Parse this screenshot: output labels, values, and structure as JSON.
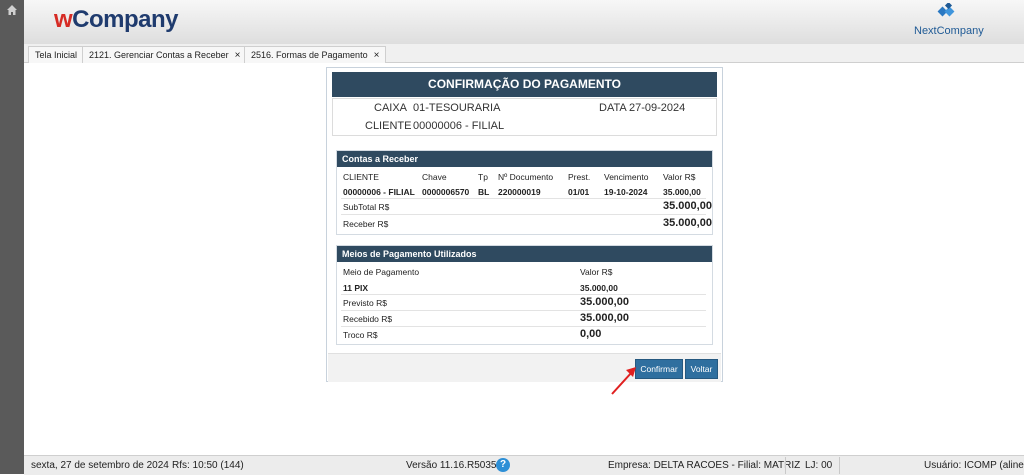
{
  "header": {
    "logo_w": "w",
    "logo_rest": "Company",
    "partner_logo": "NextCompany",
    "home_icon": "home-icon"
  },
  "tabs": [
    {
      "label": "Tela Inicial",
      "closable": false
    },
    {
      "label": "2121. Gerenciar Contas a Receber",
      "closable": true
    },
    {
      "label": "2516. Formas de Pagamento",
      "closable": true
    }
  ],
  "tab_close": "×",
  "dialog": {
    "title": "CONFIRMAÇÃO DO PAGAMENTO",
    "caixa_label": "CAIXA",
    "caixa_value": "01-TESOURARIA",
    "data_label": "DATA",
    "data_value": "27-09-2024",
    "cliente_label": "CLIENTE",
    "cliente_value": "00000006 - FILIAL"
  },
  "contas": {
    "title": "Contas a Receber",
    "columns": [
      "CLIENTE",
      "Chave",
      "Tp",
      "Nº Documento",
      "Prest.",
      "Vencimento",
      "Valor R$"
    ],
    "row": [
      "00000006 - FILIAL",
      "0000006570",
      "BL",
      "220000019",
      "01/01",
      "19-10-2024",
      "35.000,00"
    ],
    "subtotal_label": "SubTotal R$",
    "subtotal_value": "35.000,00",
    "receber_label": "Receber R$",
    "receber_value": "35.000,00"
  },
  "meios": {
    "title": "Meios de Pagamento Utilizados",
    "col_meio": "Meio de Pagamento",
    "col_valor": "Valor R$",
    "row_meio": "11 PIX",
    "row_valor": "35.000,00",
    "previsto_label": "Previsto R$",
    "previsto_value": "35.000,00",
    "recebido_label": "Recebido R$",
    "recebido_value": "35.000,00",
    "troco_label": "Troco R$",
    "troco_value": "0,00"
  },
  "buttons": {
    "confirmar": "Confirmar",
    "voltar": "Voltar"
  },
  "status": {
    "date": "sexta, 27 de setembro de 2024",
    "rfs": "Rfs: 10:50 (144)",
    "versao": "Versão 11.16.R5035",
    "empresa": "Empresa: DELTA RACOES - Filial: MATRIZ",
    "lj": "LJ: 00",
    "usuario": "Usuário: ICOMP (aline)"
  },
  "colors": {
    "header_blue": "#2f4a60",
    "button_blue": "#2f6f9f",
    "logo_red": "#d62b24",
    "logo_navy": "#1f3b6e",
    "arrow_red": "#e02020"
  }
}
